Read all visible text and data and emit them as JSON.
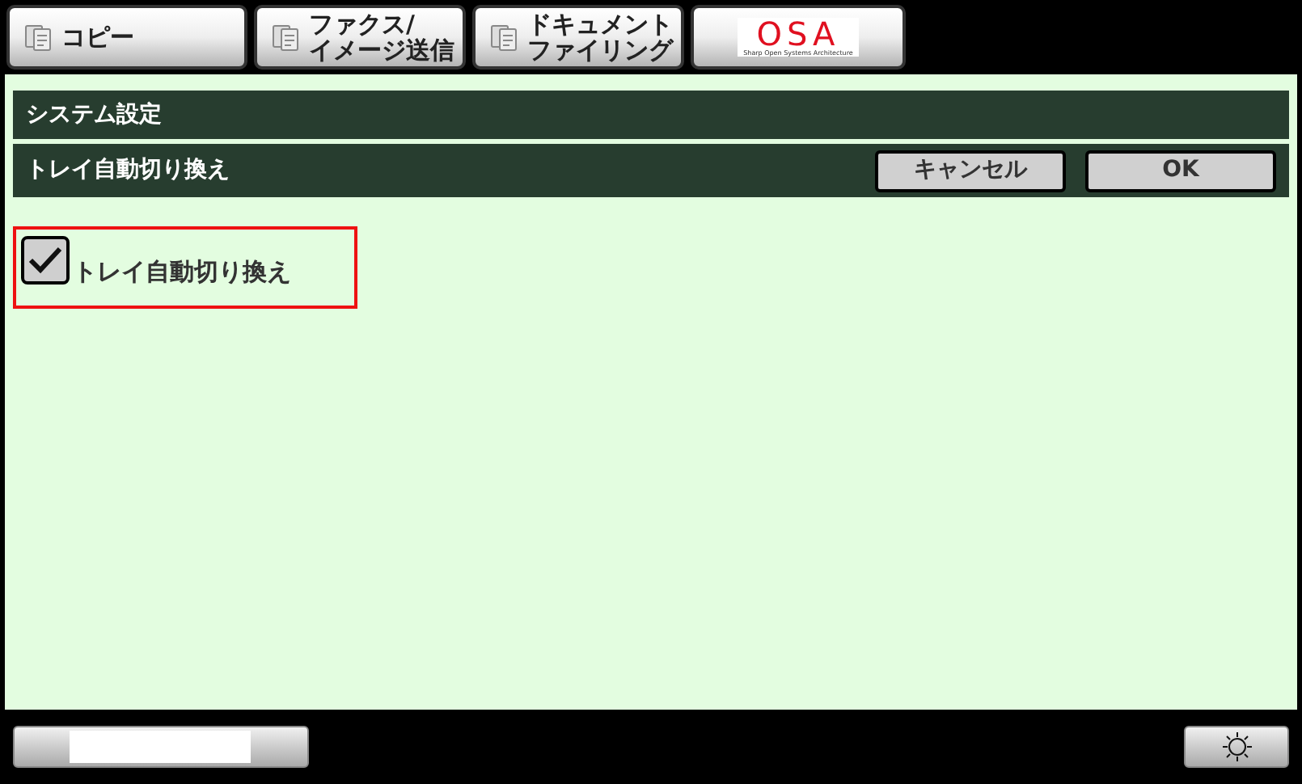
{
  "tabs": [
    {
      "lines": [
        "コピー"
      ],
      "selected": false
    },
    {
      "lines": [
        "ファクス/",
        "イメージ送信"
      ],
      "selected": false
    },
    {
      "lines": [
        "ドキュメント",
        "ファイリング"
      ],
      "selected": false
    },
    {
      "kind": "logo",
      "label": "OSA",
      "sublabel": "Sharp Open Systems Architecture",
      "selected": false
    }
  ],
  "breadcrumb": "システム設定",
  "panel": {
    "title": "トレイ自動切り換え",
    "buttons": [
      "キャンセル",
      "OK"
    ]
  },
  "settings": [
    {
      "label": "トレイ自動切り換え",
      "checked": true,
      "highlighted": true
    }
  ]
}
